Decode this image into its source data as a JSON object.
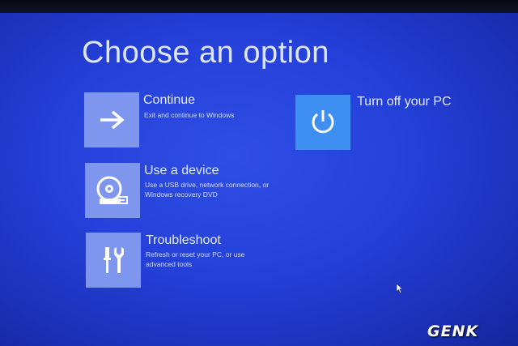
{
  "screen": {
    "title": "Choose an option"
  },
  "options": [
    {
      "title": "Continue",
      "description": "Exit and continue to Windows",
      "icon": "arrow-right-icon"
    },
    {
      "title": "Use a device",
      "description": "Use a USB drive, network connection, or Windows recovery DVD",
      "icon": "disc-drive-icon"
    },
    {
      "title": "Troubleshoot",
      "description": "Refresh or reset your PC, or use advanced tools",
      "icon": "tools-icon"
    },
    {
      "title": "Turn off your PC",
      "description": "",
      "icon": "power-icon"
    }
  ],
  "colors": {
    "background": "#2440d8",
    "tile": "#7f96ee",
    "power_tile": "#3f8ef2",
    "text": "#e6ecff"
  },
  "watermark": {
    "text": "GENK"
  }
}
